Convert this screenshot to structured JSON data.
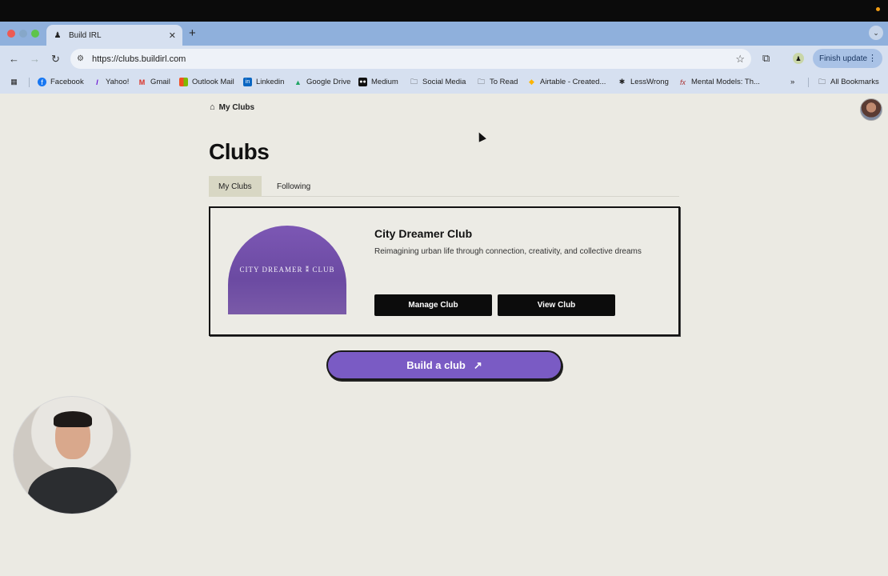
{
  "browser": {
    "tab_title": "Build IRL",
    "url": "https://clubs.buildirl.com",
    "finish_update_label": "Finish update",
    "bookmarks": [
      {
        "label": "Facebook",
        "icon": "facebook-icon"
      },
      {
        "label": "Yahoo!",
        "icon": "yahoo-icon"
      },
      {
        "label": "Gmail",
        "icon": "gmail-icon"
      },
      {
        "label": "Outlook Mail",
        "icon": "outlook-icon"
      },
      {
        "label": "Linkedin",
        "icon": "linkedin-icon"
      },
      {
        "label": "Google Drive",
        "icon": "google-drive-icon"
      },
      {
        "label": "Medium",
        "icon": "medium-icon"
      },
      {
        "label": "Social Media",
        "icon": "folder-icon"
      },
      {
        "label": "To Read",
        "icon": "folder-icon"
      },
      {
        "label": "Airtable - Created...",
        "icon": "airtable-icon"
      },
      {
        "label": "LessWrong",
        "icon": "lesswrong-icon"
      },
      {
        "label": "Mental Models: Th...",
        "icon": "fx-icon"
      }
    ],
    "all_bookmarks_label": "All Bookmarks"
  },
  "page": {
    "breadcrumb": "My Clubs",
    "title": "Clubs",
    "tabs": [
      {
        "label": "My Clubs",
        "active": true
      },
      {
        "label": "Following",
        "active": false
      }
    ],
    "club": {
      "image_text": "CITY DREAMER ⁑ CLUB",
      "name": "City Dreamer Club",
      "description": "Reimagining urban life through connection, creativity, and collective dreams",
      "manage_label": "Manage Club",
      "view_label": "View Club"
    },
    "build_button_label": "Build a club"
  },
  "colors": {
    "accent_purple": "#7a5bc4",
    "page_bg": "#ebeae3",
    "active_tab_bg": "#d8d7c4"
  }
}
